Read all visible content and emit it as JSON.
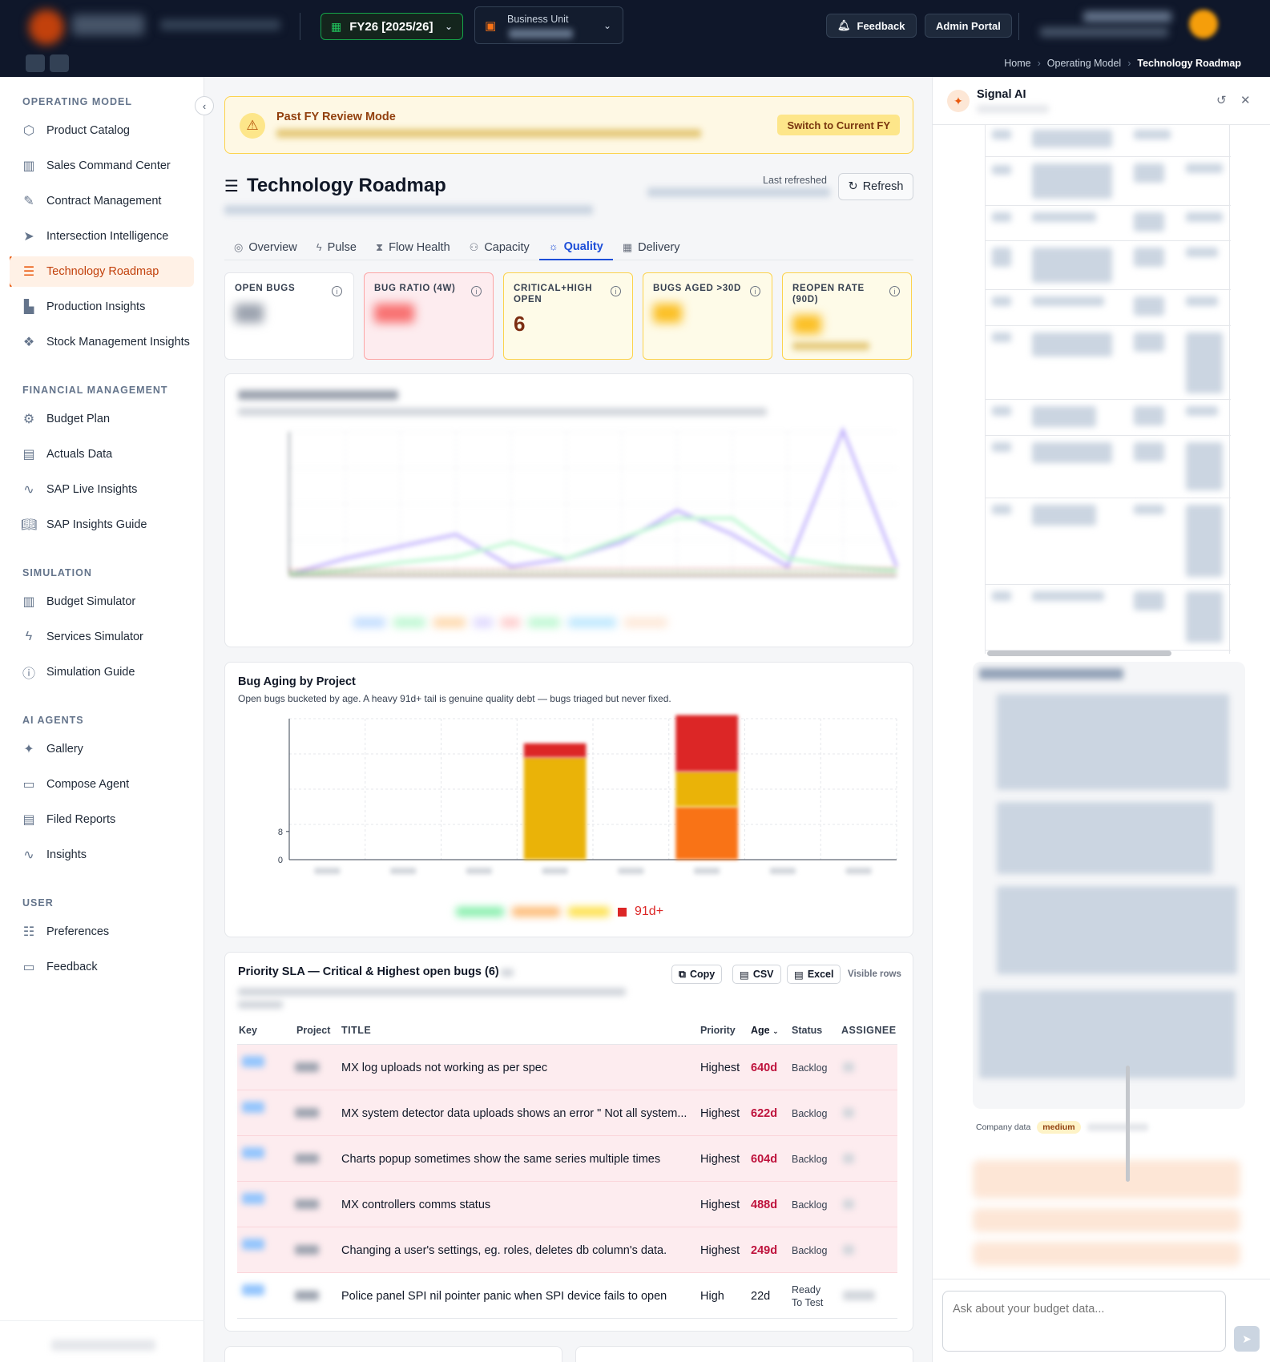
{
  "topbar": {
    "fy_label": "FY26 [2025/26]",
    "bu_label": "Business Unit",
    "feedback_label": "Feedback",
    "admin_label": "Admin Portal",
    "breadcrumb": [
      "Home",
      "Operating Model",
      "Technology Roadmap"
    ]
  },
  "sidebar": {
    "sections": [
      {
        "title": "OPERATING MODEL",
        "items": [
          {
            "label": "Product Catalog",
            "icon": "cube-icon"
          },
          {
            "label": "Sales Command Center",
            "icon": "bar-chart-icon"
          },
          {
            "label": "Contract Management",
            "icon": "edit-document-icon"
          },
          {
            "label": "Intersection Intelligence",
            "icon": "send-icon"
          },
          {
            "label": "Technology Roadmap",
            "icon": "roadmap-icon",
            "active": true
          },
          {
            "label": "Production Insights",
            "icon": "factory-icon"
          },
          {
            "label": "Stock Management Insights",
            "icon": "boxes-icon"
          }
        ]
      },
      {
        "title": "FINANCIAL MANAGEMENT",
        "items": [
          {
            "label": "Budget Plan",
            "icon": "gear-icon"
          },
          {
            "label": "Actuals Data",
            "icon": "document-icon"
          },
          {
            "label": "SAP Live Insights",
            "icon": "activity-icon"
          },
          {
            "label": "SAP Insights Guide",
            "icon": "book-icon"
          }
        ]
      },
      {
        "title": "SIMULATION",
        "items": [
          {
            "label": "Budget Simulator",
            "icon": "bar-chart-icon"
          },
          {
            "label": "Services Simulator",
            "icon": "lightning-icon"
          },
          {
            "label": "Simulation Guide",
            "icon": "help-circle-icon"
          }
        ]
      },
      {
        "title": "AI AGENTS",
        "items": [
          {
            "label": "Gallery",
            "icon": "sparkles-icon"
          },
          {
            "label": "Compose Agent",
            "icon": "chat-icon"
          },
          {
            "label": "Filed Reports",
            "icon": "document-icon"
          },
          {
            "label": "Insights",
            "icon": "activity-icon"
          }
        ]
      },
      {
        "title": "USER",
        "items": [
          {
            "label": "Preferences",
            "icon": "sliders-icon"
          },
          {
            "label": "Feedback",
            "icon": "chat-icon"
          }
        ]
      }
    ]
  },
  "banner": {
    "title": "Past FY Review Mode",
    "switch_label": "Switch to Current FY"
  },
  "page": {
    "title": "Technology Roadmap",
    "last_refreshed_label": "Last refreshed",
    "refresh_label": "Refresh"
  },
  "tabs": [
    {
      "label": "Overview",
      "icon": "target-icon"
    },
    {
      "label": "Pulse",
      "icon": "lightning-icon"
    },
    {
      "label": "Flow Health",
      "icon": "hourglass-icon"
    },
    {
      "label": "Capacity",
      "icon": "users-icon"
    },
    {
      "label": "Quality",
      "icon": "bug-icon",
      "active": true
    },
    {
      "label": "Delivery",
      "icon": "calendar-icon"
    }
  ],
  "kpis": [
    {
      "label": "OPEN BUGS",
      "value": null,
      "tone": "plain"
    },
    {
      "label": "BUG RATIO (4W)",
      "value": null,
      "tone": "red"
    },
    {
      "label": "CRITICAL+HIGH OPEN",
      "value": "6",
      "tone": "yellow"
    },
    {
      "label": "BUGS AGED >30D",
      "value": null,
      "tone": "yellow"
    },
    {
      "label": "REOPEN RATE (90D)",
      "value": null,
      "tone": "yellow"
    }
  ],
  "aging_card": {
    "title": "Bug Aging by Project",
    "description": "Open bugs bucketed by age. A heavy 91d+ tail is genuine quality debt — bugs triaged but never fixed.",
    "legend_visible": "91d+"
  },
  "chart_data": {
    "type": "bar",
    "stacked": true,
    "title": "Bug Aging by Project",
    "y_ticks": [
      "0",
      "8"
    ],
    "categories": [
      "",
      "",
      "",
      "",
      "",
      "",
      "",
      ""
    ],
    "series": [
      {
        "name": "",
        "color": "#22c55e",
        "values": [
          0,
          0,
          0,
          0,
          0,
          0,
          0,
          0
        ]
      },
      {
        "name": "",
        "color": "#f97316",
        "values": [
          0,
          0,
          0,
          0,
          0,
          15,
          0,
          0
        ]
      },
      {
        "name": "",
        "color": "#eab308",
        "values": [
          0,
          0,
          0,
          29,
          0,
          10,
          0,
          0
        ]
      },
      {
        "name": "91d+",
        "color": "#dc2626",
        "values": [
          0,
          0,
          0,
          4,
          0,
          16,
          0,
          0
        ]
      }
    ],
    "ylim": [
      0,
      40
    ],
    "grid": true,
    "legend": "bottom"
  },
  "sla_card": {
    "title": "Priority SLA — Critical & Highest open bugs (6)",
    "copy_label": "Copy",
    "csv_label": "CSV",
    "excel_label": "Excel",
    "visible_rows_label": "Visible rows",
    "columns": [
      "Key",
      "Project",
      "TITLE",
      "Priority",
      "Age",
      "Status",
      "ASSIGNEE"
    ],
    "rows": [
      {
        "title": "MX log uploads not working as per spec",
        "priority": "Highest",
        "age": "640d",
        "status": "Backlog",
        "critical": true
      },
      {
        "title": "MX system detector data uploads shows an error \" Not all system...",
        "priority": "Highest",
        "age": "622d",
        "status": "Backlog",
        "critical": true
      },
      {
        "title": "Charts popup sometimes show the same series multiple times",
        "priority": "Highest",
        "age": "604d",
        "status": "Backlog",
        "critical": true
      },
      {
        "title": "MX controllers comms status",
        "priority": "Highest",
        "age": "488d",
        "status": "Backlog",
        "critical": true
      },
      {
        "title": "Changing a user's settings, eg. roles, deletes db column's data.",
        "priority": "Highest",
        "age": "249d",
        "status": "Backlog",
        "critical": true
      },
      {
        "title": "Police panel SPI nil pointer panic when SPI device fails to open",
        "priority": "High",
        "age": "22d",
        "status": "Ready To Test",
        "critical": false
      }
    ]
  },
  "ai_panel": {
    "title": "Signal AI",
    "company_data_label": "Company data",
    "confidence_badge": "medium",
    "input_placeholder": "Ask about your budget data..."
  },
  "colors": {
    "accent": "#ea580c",
    "active_tab": "#1d4ed8",
    "topbar": "#0f172a",
    "critical_row": "#fdecef"
  }
}
